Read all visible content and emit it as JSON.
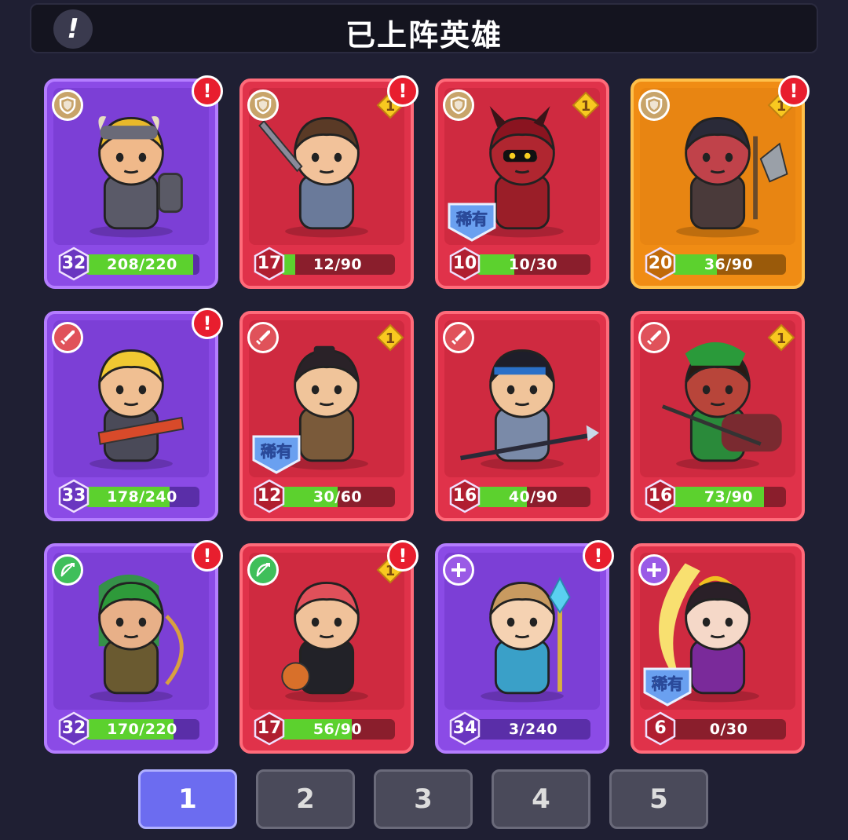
{
  "header": {
    "title": "已上阵英雄",
    "info_icon": "!"
  },
  "colors": {
    "purple": "#8b4be6",
    "red": "#e0324a",
    "orange": "#f08c14",
    "progress": "#5cd12e"
  },
  "heroes": [
    {
      "rarity": "purple",
      "class": "shield-icon",
      "level": "32",
      "progress": "208/220",
      "fill": 0.945,
      "star": null,
      "rare": null,
      "alert": true,
      "look": "viking"
    },
    {
      "rarity": "red",
      "class": "shield-icon",
      "level": "17",
      "progress": "12/90",
      "fill": 0.133,
      "star": "1",
      "rare": null,
      "alert": true,
      "look": "knight"
    },
    {
      "rarity": "red",
      "class": "shield-icon",
      "level": "10",
      "progress": "10/30",
      "fill": 0.333,
      "star": "1",
      "rare": "稀有",
      "alert": false,
      "look": "demon"
    },
    {
      "rarity": "orange",
      "class": "shield-icon",
      "level": "20",
      "progress": "36/90",
      "fill": 0.4,
      "star": "1",
      "rare": null,
      "alert": true,
      "look": "ogre"
    },
    {
      "rarity": "purple",
      "class": "sword-icon",
      "level": "33",
      "progress": "178/240",
      "fill": 0.742,
      "star": null,
      "rare": null,
      "alert": true,
      "look": "blonde"
    },
    {
      "rarity": "red",
      "class": "sword-icon",
      "level": "12",
      "progress": "30/60",
      "fill": 0.5,
      "star": "1",
      "rare": "稀有",
      "alert": false,
      "look": "robed"
    },
    {
      "rarity": "red",
      "class": "sword-icon",
      "level": "16",
      "progress": "40/90",
      "fill": 0.444,
      "star": null,
      "rare": null,
      "alert": false,
      "look": "spear"
    },
    {
      "rarity": "red",
      "class": "sword-icon",
      "level": "16",
      "progress": "73/90",
      "fill": 0.811,
      "star": "1",
      "rare": null,
      "alert": false,
      "look": "general"
    },
    {
      "rarity": "purple",
      "class": "bow-icon",
      "level": "32",
      "progress": "170/220",
      "fill": 0.773,
      "star": null,
      "rare": null,
      "alert": true,
      "look": "elf"
    },
    {
      "rarity": "red",
      "class": "bow-icon",
      "level": "17",
      "progress": "56/90",
      "fill": 0.622,
      "star": "1",
      "rare": null,
      "alert": true,
      "look": "redhair"
    },
    {
      "rarity": "purple",
      "class": "heal-icon",
      "level": "34",
      "progress": "3/240",
      "fill": 0.0125,
      "star": null,
      "rare": null,
      "alert": true,
      "look": "mage"
    },
    {
      "rarity": "red",
      "class": "heal-icon",
      "level": "6",
      "progress": "0/30",
      "fill": 0,
      "star": null,
      "rare": "稀有",
      "alert": false,
      "look": "moon"
    }
  ],
  "pages": [
    "1",
    "2",
    "3",
    "4",
    "5"
  ],
  "active_page": "1"
}
